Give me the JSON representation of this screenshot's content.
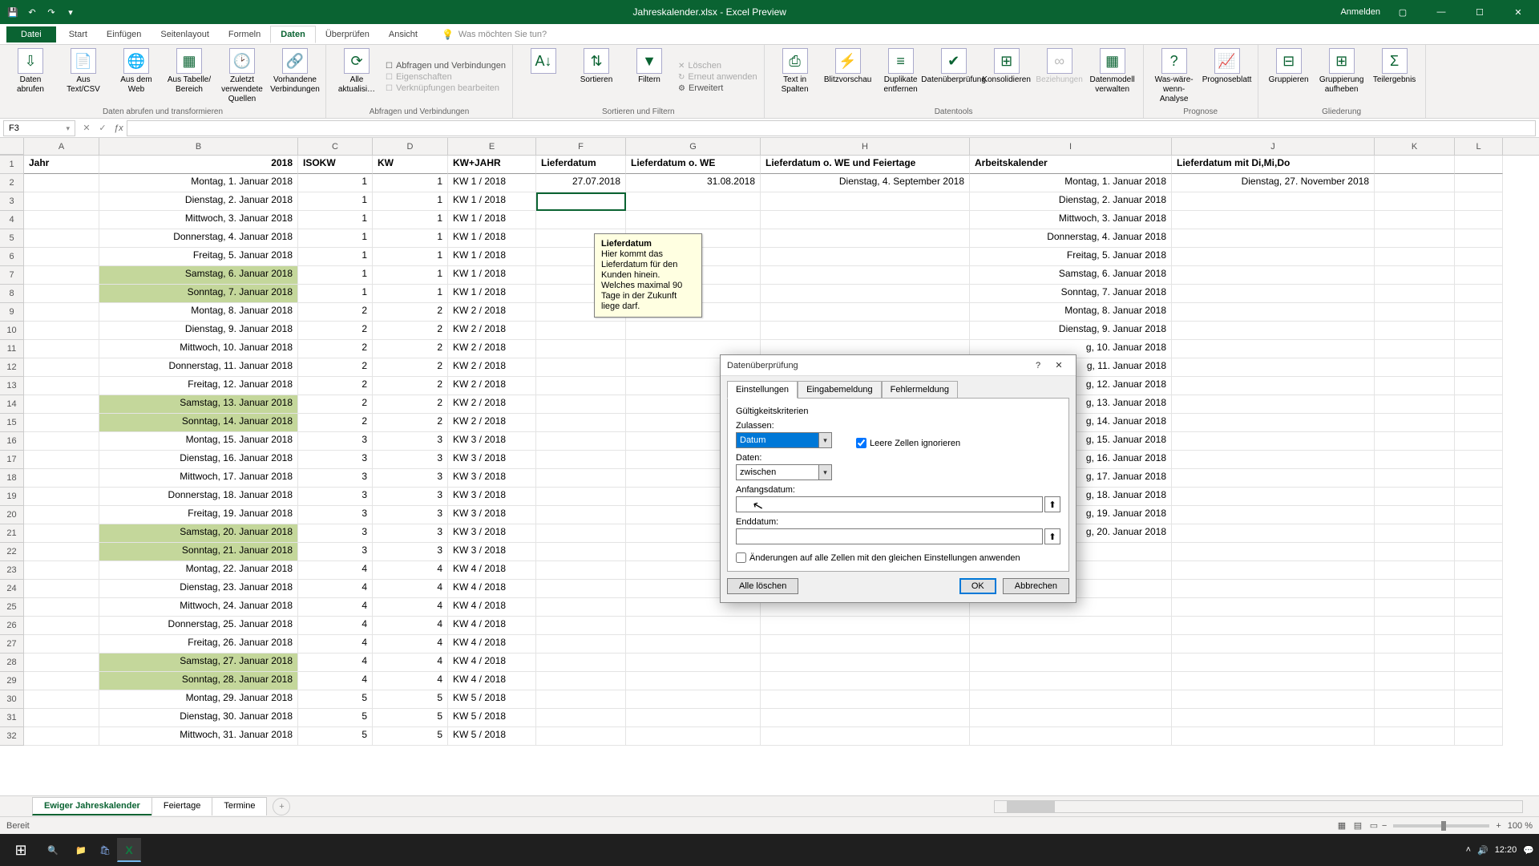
{
  "titlebar": {
    "title": "Jahreskalender.xlsx - Excel Preview",
    "signin": "Anmelden"
  },
  "tabs": {
    "file": "Datei",
    "items": [
      "Start",
      "Einfügen",
      "Seitenlayout",
      "Formeln",
      "Daten",
      "Überprüfen",
      "Ansicht"
    ],
    "tell_placeholder": "Was möchten Sie tun?"
  },
  "ribbon": {
    "g1": {
      "name": "Daten abrufen und transformieren",
      "daten_abrufen": "Daten abrufen",
      "aus_text": "Aus Text/CSV",
      "aus_web": "Aus dem Web",
      "aus_tabelle": "Aus Tabelle/\nBereich",
      "zuletzt": "Zuletzt verwendete\nQuellen",
      "vorhandene": "Vorhandene\nVerbindungen"
    },
    "g2": {
      "name": "Abfragen und Verbindungen",
      "alle_akt": "Alle aktualisi…",
      "q1": "Abfragen und Verbindungen",
      "q2": "Eigenschaften",
      "q3": "Verknüpfungen bearbeiten"
    },
    "g3": {
      "name": "Sortieren und Filtern",
      "sort": "Sortieren",
      "filt": "Filtern",
      "f1": "Löschen",
      "f2": "Erneut anwenden",
      "f3": "Erweitert"
    },
    "g4": {
      "name": "Datentools",
      "t1": "Text in Spalten",
      "t2": "Blitzvorschau",
      "t3": "Duplikate entfernen",
      "t4": "Datenüberprüfung",
      "t5": "Konsolidieren",
      "t6": "Beziehungen",
      "t7": "Datenmodell verwalten"
    },
    "g5": {
      "name": "Prognose",
      "w1": "Was-wäre-wenn-Analyse",
      "w2": "Prognoseblatt"
    },
    "g6": {
      "name": "Gliederung",
      "o1": "Gruppieren",
      "o2": "Gruppierung aufheben",
      "o3": "Teilergebnis"
    }
  },
  "namebox": "F3",
  "colHeaders": [
    "A",
    "B",
    "C",
    "D",
    "E",
    "F",
    "G",
    "H",
    "I",
    "J",
    "K",
    "L"
  ],
  "headers": {
    "A": "Jahr",
    "B": "2018",
    "C": "ISOKW",
    "D": "KW",
    "E": "KW+JAHR",
    "F": "Lieferdatum",
    "G": "Lieferdatum o. WE",
    "H": "Lieferdatum o. WE und Feiertage",
    "I": "Arbeitskalender",
    "J": "Lieferdatum mit Di,Mi,Do"
  },
  "rows": [
    {
      "n": 2,
      "B": "Montag, 1. Januar 2018",
      "C": "1",
      "D": "1",
      "E": "KW 1 / 2018",
      "F": "27.07.2018",
      "G": "31.08.2018",
      "H": "Dienstag, 4. September 2018",
      "I": "Montag, 1. Januar 2018",
      "J": "Dienstag, 27. November 2018"
    },
    {
      "n": 3,
      "B": "Dienstag, 2. Januar 2018",
      "C": "1",
      "D": "1",
      "E": "KW 1 / 2018",
      "I": "Dienstag, 2. Januar 2018",
      "sel": true
    },
    {
      "n": 4,
      "B": "Mittwoch, 3. Januar 2018",
      "C": "1",
      "D": "1",
      "E": "KW 1 / 2018",
      "I": "Mittwoch, 3. Januar 2018"
    },
    {
      "n": 5,
      "B": "Donnerstag, 4. Januar 2018",
      "C": "1",
      "D": "1",
      "E": "KW 1 / 2018",
      "I": "Donnerstag, 4. Januar 2018"
    },
    {
      "n": 6,
      "B": "Freitag, 5. Januar 2018",
      "C": "1",
      "D": "1",
      "E": "KW 1 / 2018",
      "I": "Freitag, 5. Januar 2018"
    },
    {
      "n": 7,
      "B": "Samstag, 6. Januar 2018",
      "C": "1",
      "D": "1",
      "E": "KW 1 / 2018",
      "I": "Samstag, 6. Januar 2018",
      "we": true
    },
    {
      "n": 8,
      "B": "Sonntag, 7. Januar 2018",
      "C": "1",
      "D": "1",
      "E": "KW 1 / 2018",
      "I": "Sonntag, 7. Januar 2018",
      "we": true
    },
    {
      "n": 9,
      "B": "Montag, 8. Januar 2018",
      "C": "2",
      "D": "2",
      "E": "KW 2 / 2018",
      "I": "Montag, 8. Januar 2018"
    },
    {
      "n": 10,
      "B": "Dienstag, 9. Januar 2018",
      "C": "2",
      "D": "2",
      "E": "KW 2 / 2018",
      "I": "Dienstag, 9. Januar 2018"
    },
    {
      "n": 11,
      "B": "Mittwoch, 10. Januar 2018",
      "C": "2",
      "D": "2",
      "E": "KW 2 / 2018",
      "I": "g, 10. Januar 2018"
    },
    {
      "n": 12,
      "B": "Donnerstag, 11. Januar 2018",
      "C": "2",
      "D": "2",
      "E": "KW 2 / 2018",
      "I": "g, 11. Januar 2018"
    },
    {
      "n": 13,
      "B": "Freitag, 12. Januar 2018",
      "C": "2",
      "D": "2",
      "E": "KW 2 / 2018",
      "I": "g, 12. Januar 2018"
    },
    {
      "n": 14,
      "B": "Samstag, 13. Januar 2018",
      "C": "2",
      "D": "2",
      "E": "KW 2 / 2018",
      "I": "g, 13. Januar 2018",
      "we": true
    },
    {
      "n": 15,
      "B": "Sonntag, 14. Januar 2018",
      "C": "2",
      "D": "2",
      "E": "KW 2 / 2018",
      "I": "g, 14. Januar 2018",
      "we": true
    },
    {
      "n": 16,
      "B": "Montag, 15. Januar 2018",
      "C": "3",
      "D": "3",
      "E": "KW 3 / 2018",
      "I": "g, 15. Januar 2018"
    },
    {
      "n": 17,
      "B": "Dienstag, 16. Januar 2018",
      "C": "3",
      "D": "3",
      "E": "KW 3 / 2018",
      "I": "g, 16. Januar 2018"
    },
    {
      "n": 18,
      "B": "Mittwoch, 17. Januar 2018",
      "C": "3",
      "D": "3",
      "E": "KW 3 / 2018",
      "I": "g, 17. Januar 2018"
    },
    {
      "n": 19,
      "B": "Donnerstag, 18. Januar 2018",
      "C": "3",
      "D": "3",
      "E": "KW 3 / 2018",
      "I": "g, 18. Januar 2018"
    },
    {
      "n": 20,
      "B": "Freitag, 19. Januar 2018",
      "C": "3",
      "D": "3",
      "E": "KW 3 / 2018",
      "I": "g, 19. Januar 2018"
    },
    {
      "n": 21,
      "B": "Samstag, 20. Januar 2018",
      "C": "3",
      "D": "3",
      "E": "KW 3 / 2018",
      "I": "g, 20. Januar 2018",
      "we": true
    },
    {
      "n": 22,
      "B": "Sonntag, 21. Januar 2018",
      "C": "3",
      "D": "3",
      "E": "KW 3 / 2018",
      "we": true
    },
    {
      "n": 23,
      "B": "Montag, 22. Januar 2018",
      "C": "4",
      "D": "4",
      "E": "KW 4 / 2018"
    },
    {
      "n": 24,
      "B": "Dienstag, 23. Januar 2018",
      "C": "4",
      "D": "4",
      "E": "KW 4 / 2018"
    },
    {
      "n": 25,
      "B": "Mittwoch, 24. Januar 2018",
      "C": "4",
      "D": "4",
      "E": "KW 4 / 2018"
    },
    {
      "n": 26,
      "B": "Donnerstag, 25. Januar 2018",
      "C": "4",
      "D": "4",
      "E": "KW 4 / 2018"
    },
    {
      "n": 27,
      "B": "Freitag, 26. Januar 2018",
      "C": "4",
      "D": "4",
      "E": "KW 4 / 2018"
    },
    {
      "n": 28,
      "B": "Samstag, 27. Januar 2018",
      "C": "4",
      "D": "4",
      "E": "KW 4 / 2018",
      "we": true
    },
    {
      "n": 29,
      "B": "Sonntag, 28. Januar 2018",
      "C": "4",
      "D": "4",
      "E": "KW 4 / 2018",
      "we": true
    },
    {
      "n": 30,
      "B": "Montag, 29. Januar 2018",
      "C": "5",
      "D": "5",
      "E": "KW 5 / 2018"
    },
    {
      "n": 31,
      "B": "Dienstag, 30. Januar 2018",
      "C": "5",
      "D": "5",
      "E": "KW 5 / 2018"
    },
    {
      "n": 32,
      "B": "Mittwoch, 31. Januar 2018",
      "C": "5",
      "D": "5",
      "E": "KW 5 / 2018"
    }
  ],
  "tooltip": {
    "title": "Lieferdatum",
    "body": "Hier kommt das Lieferdatum für den Kunden hinein. Welches maximal 90 Tage in der Zukunft liege darf."
  },
  "dialog": {
    "title": "Datenüberprüfung",
    "tabs": [
      "Einstellungen",
      "Eingabemeldung",
      "Fehlermeldung"
    ],
    "criteria": "Gültigkeitskriterien",
    "allow_label": "Zulassen:",
    "allow_value": "Datum",
    "ignore_blank": "Leere Zellen ignorieren",
    "data_label": "Daten:",
    "data_value": "zwischen",
    "start_label": "Anfangsdatum:",
    "end_label": "Enddatum:",
    "apply_same": "Änderungen auf alle Zellen mit den gleichen Einstellungen anwenden",
    "clear": "Alle löschen",
    "ok": "OK",
    "cancel": "Abbrechen"
  },
  "sheet_tabs": [
    "Ewiger Jahreskalender",
    "Feiertage",
    "Termine"
  ],
  "status": {
    "ready": "Bereit",
    "zoom": "100 %"
  },
  "taskbar": {
    "time": "12:20",
    "date": ""
  }
}
